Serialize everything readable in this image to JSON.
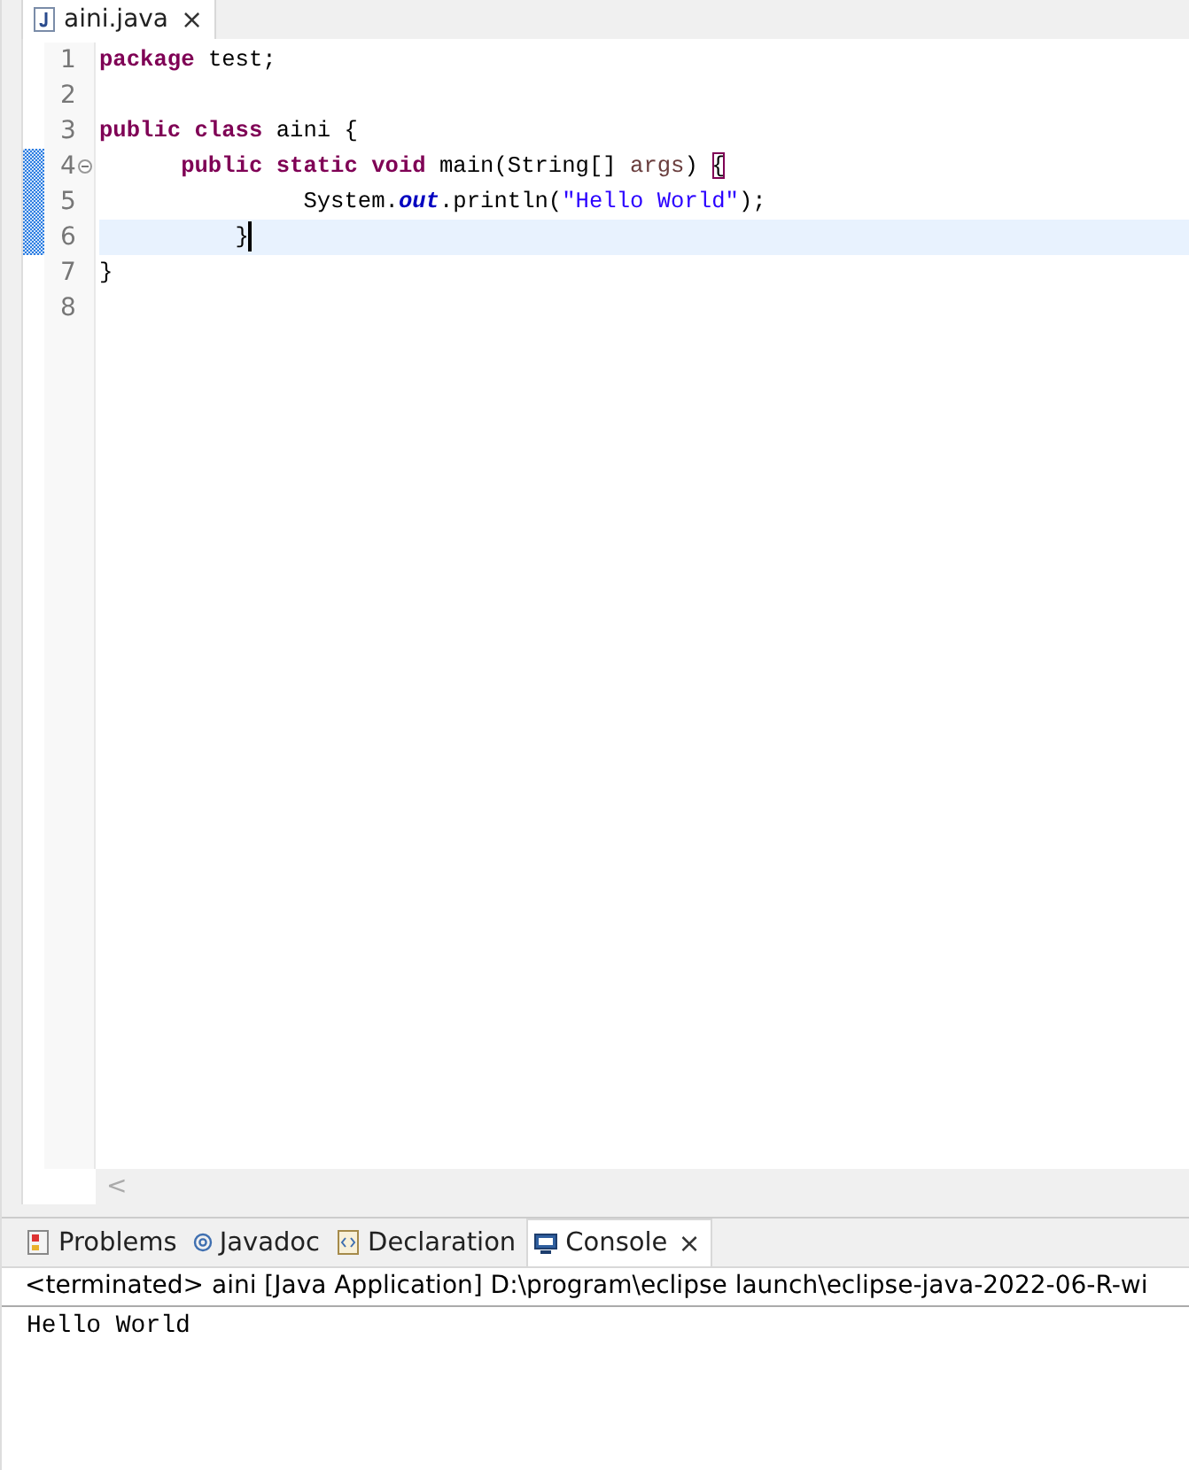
{
  "editor_tab": {
    "label": "aini.java",
    "close": "×",
    "selected": true
  },
  "lines": [
    {
      "number": "1",
      "changed": false,
      "current": false,
      "foldable": false,
      "tokens": [
        {
          "kind": "keyword",
          "text": "package"
        },
        {
          "kind": "plain",
          "text": " test;"
        }
      ]
    },
    {
      "number": "2",
      "changed": false,
      "current": false,
      "foldable": false
    },
    {
      "number": "3",
      "changed": false,
      "current": false,
      "foldable": false,
      "tokens": [
        {
          "kind": "keyword",
          "text": "public class"
        },
        {
          "kind": "plain",
          "text": " aini {"
        }
      ]
    },
    {
      "number": "4",
      "changed": true,
      "current": false,
      "foldable": true,
      "tokens": [
        {
          "kind": "keyword",
          "text": "      public static void"
        },
        {
          "kind": "plain",
          "text": " main(String[] "
        },
        {
          "kind": "param",
          "text": "args"
        },
        {
          "kind": "plain",
          "text": ") "
        },
        {
          "kind": "bracket",
          "text": "{"
        }
      ]
    },
    {
      "number": "5",
      "changed": true,
      "current": false,
      "foldable": false,
      "tokens": [
        {
          "kind": "plain",
          "text": "               System."
        },
        {
          "kind": "field",
          "text": "out"
        },
        {
          "kind": "plain",
          "text": ".println("
        },
        {
          "kind": "string",
          "text": "\"Hello World\""
        },
        {
          "kind": "plain",
          "text": ");"
        }
      ]
    },
    {
      "number": "6",
      "changed": true,
      "current": true,
      "foldable": false,
      "tokens": [
        {
          "kind": "plain",
          "text": "          }"
        }
      ]
    },
    {
      "number": "7",
      "changed": false,
      "current": false,
      "foldable": false,
      "tokens": [
        {
          "kind": "plain",
          "text": "}"
        }
      ]
    },
    {
      "number": "8",
      "changed": false,
      "current": false,
      "foldable": false
    }
  ],
  "scroll_left": "<",
  "panel_tabs": [
    {
      "label": "Problems",
      "kind": "problems",
      "selected": false
    },
    {
      "label": "Javadoc",
      "kind": "javadoc",
      "selected": false
    },
    {
      "label": "Declaration",
      "kind": "declaration",
      "selected": false
    },
    {
      "label": "Console",
      "kind": "console",
      "selected": true,
      "close": "×"
    }
  ],
  "console": {
    "status": "<terminated> aini [Java Application] D:\\program\\eclipse launch\\eclipse-java-2022-06-R-wi",
    "output": "Hello World"
  }
}
